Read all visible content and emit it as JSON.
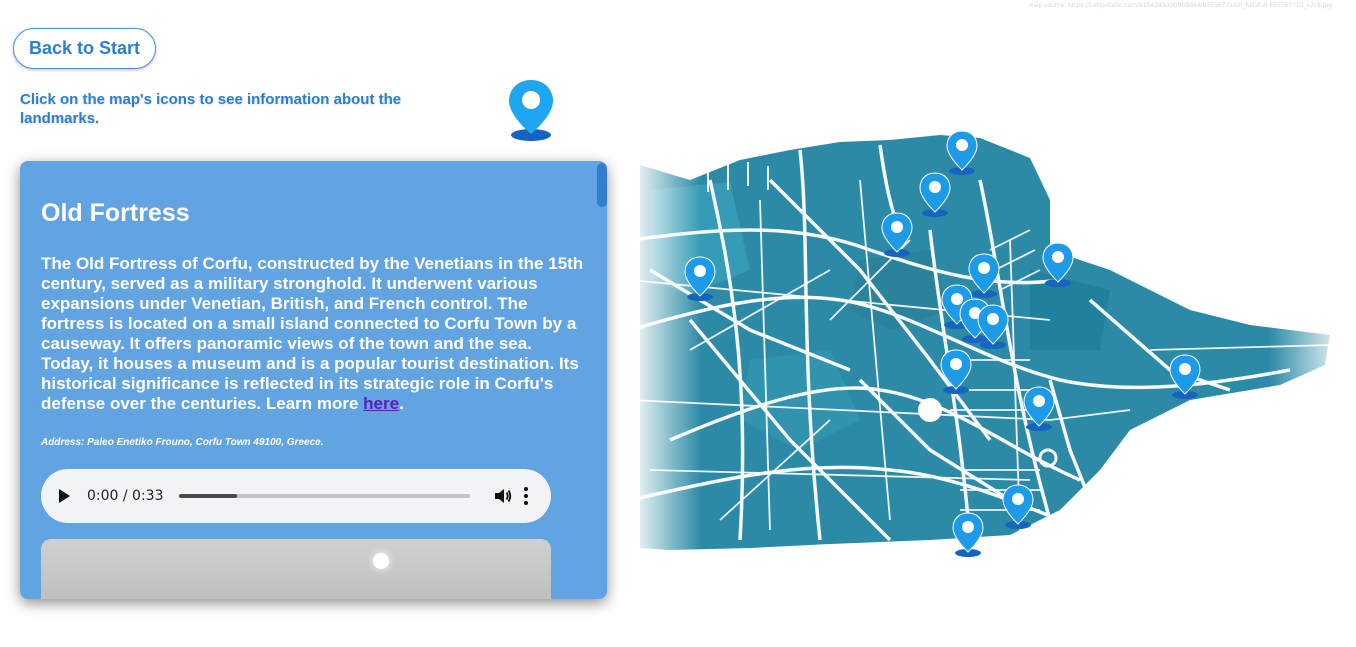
{
  "map_source": "map source: https://i.etsystatic.com/8154243/r/il/9b8d44/835567719/il_fullxfull.835567719_c7c6.jpg",
  "back_button": {
    "label": "Back to Start"
  },
  "instructions": "Click on the map's icons to see information about the landmarks.",
  "panel": {
    "title": "Old Fortress",
    "description": "The Old Fortress of Corfu, constructed by the Venetians in the 15th century, served as a military stronghold. It underwent various expansions under Venetian, British, and French control. The fortress is located on a small island connected to Corfu Town by a causeway. It offers panoramic views of the town and the sea. Today, it houses a museum and is a popular tourist destination. Its historical significance is reflected in its strategic role in Corfu's defense over the centuries. Learn more ",
    "link_text": "here",
    "period": ".",
    "address": "Address: Paleo Enetiko Frouno, Corfu Town 49100, Greece."
  },
  "audio": {
    "time": "0:00 / 0:33",
    "progress": 0.2
  },
  "colors": {
    "accent": "#2b7fd0",
    "panel": "#62a3e2",
    "map_sea": "#2c8aa6",
    "pin": "#1e9be8"
  },
  "icons": {
    "pin": "map-pin-icon",
    "play": "play-icon",
    "volume": "volume-icon",
    "more": "more-options-icon"
  }
}
